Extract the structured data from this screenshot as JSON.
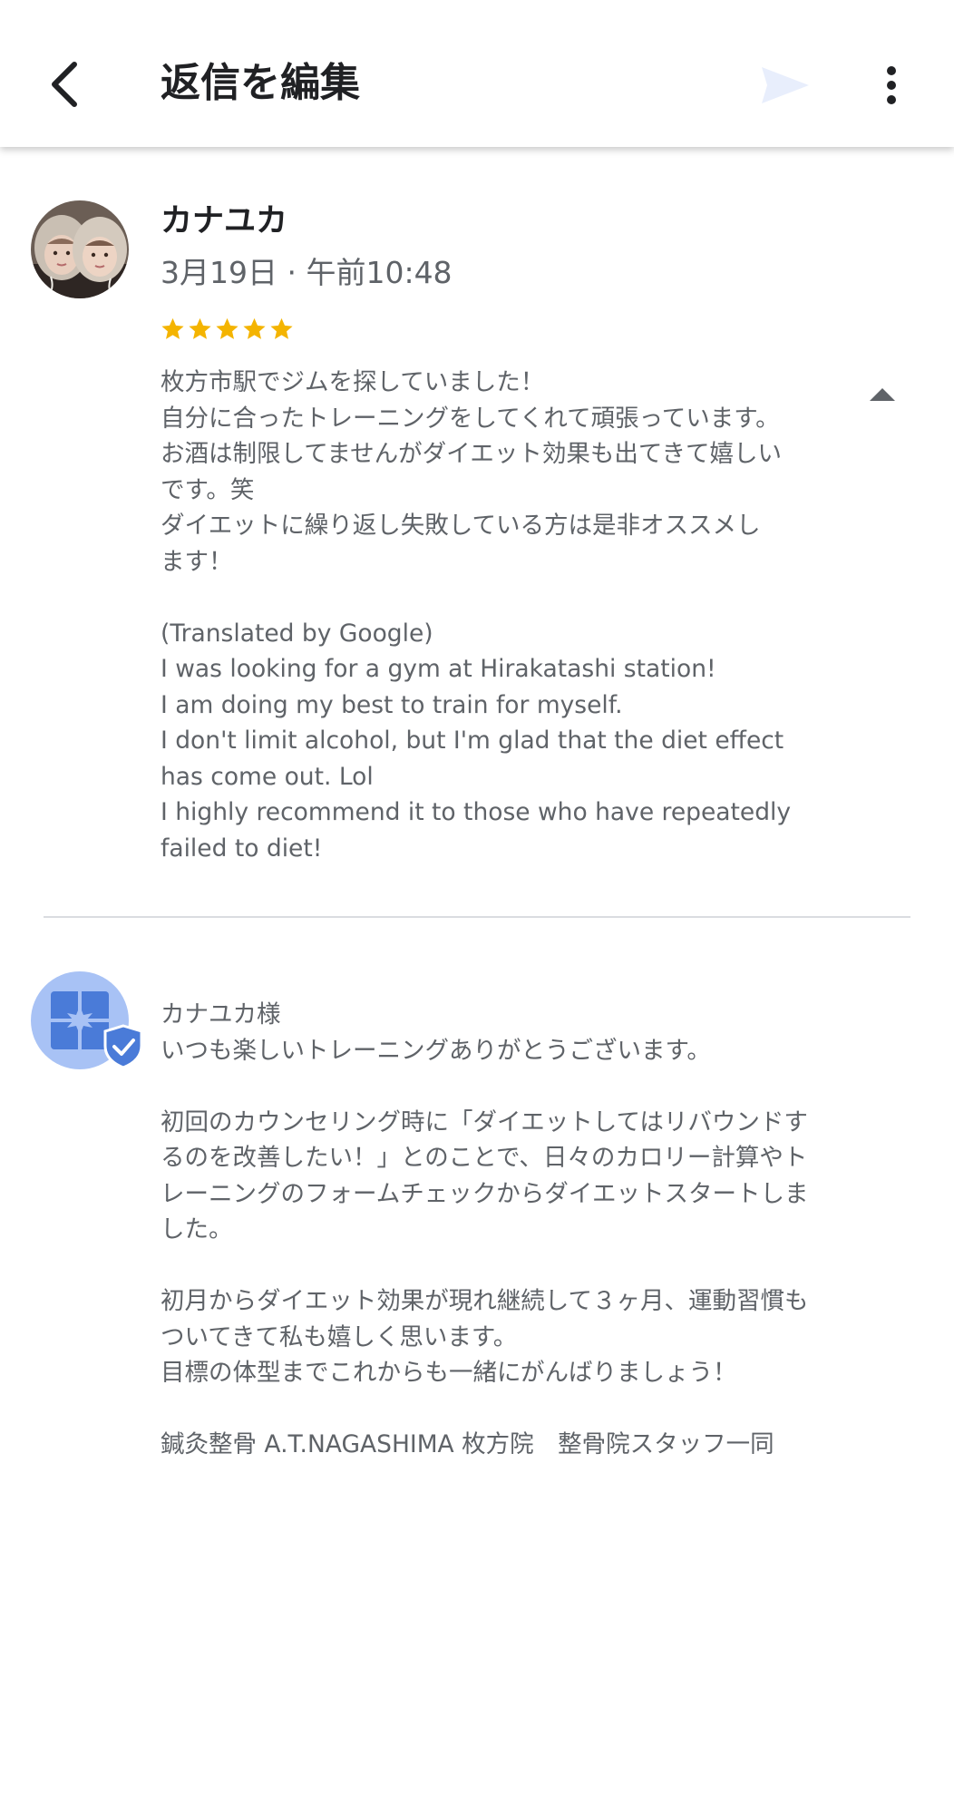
{
  "header": {
    "title": "返信を編集",
    "back_icon": "back-arrow-icon",
    "send_icon": "send-icon",
    "more_icon": "more-vert-icon"
  },
  "review": {
    "reviewer_name": "カナユカ",
    "date": "3月19日 · 午前10:48",
    "rating": 5,
    "rating_max": 5,
    "star_color": "#f4b400",
    "text": "枚方市駅でジムを探していました！\n自分に合ったトレーニングをしてくれて頑張っています。\nお酒は制限してませんがダイエット効果も出てきて嬉しい\nです。笑\nダイエットに繰り返し失敗している方は是非オススメし\nます！\n\n(Translated by Google)\nI was looking for a gym at Hirakatashi station!\nI am doing my best to train for myself.\nI don't limit alcohol, but I'm glad that the diet effect\nhas come out. Lol\nI highly recommend it to those who have repeatedly\nfailed to diet!",
    "collapse_icon": "collapse-arrow-icon"
  },
  "reply": {
    "text": "カナユカ様\nいつも楽しいトレーニングありがとうございます。\n\n初回のカウンセリング時に「ダイエットしてはリバウンドす\nるのを改善したい！」とのことで、日々のカロリー計算やト\nレーニングのフォームチェックからダイエットスタートしま\nした。\n\n初月からダイエット効果が現れ継続して３ヶ月、運動習慣も\nついてきて私も嬉しく思います。\n目標の体型までこれからも一緒にがんばりましょう！\n\n鍼灸整骨 A.T.NAGASHIMA 枚方院　整骨院スタッフ一同",
    "owner_icon": "business-verified-icon",
    "accent_color": "#4a7bd8"
  }
}
